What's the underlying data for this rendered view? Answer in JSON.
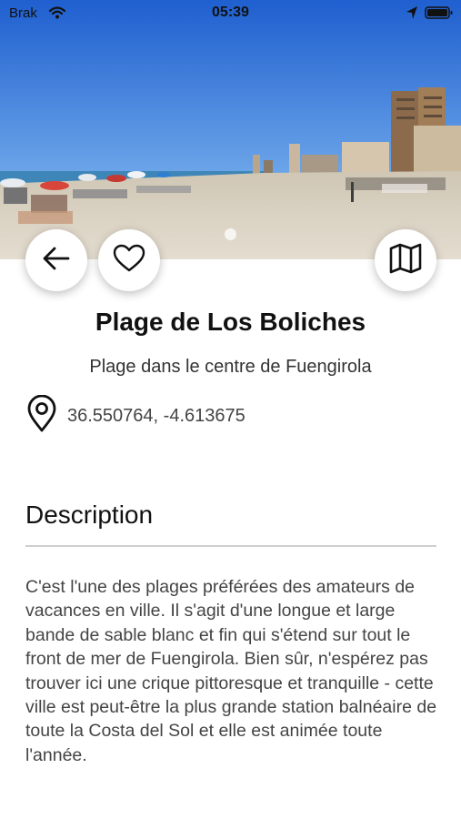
{
  "status_bar": {
    "carrier": "Brak",
    "time": "05:39",
    "icons": [
      "wifi-icon",
      "location-arrow-icon",
      "battery-icon"
    ]
  },
  "hero": {
    "image": "beach-photo",
    "pager": {
      "current_page": 1
    }
  },
  "actions": {
    "back": "arrow-left-icon",
    "favorite": "heart-icon",
    "map": "map-icon"
  },
  "place": {
    "title": "Plage de Los Boliches",
    "subtitle": "Plage dans le centre de Fuengirola",
    "coordinates": "36.550764, -4.613675",
    "coordinates_icon": "map-pin-icon"
  },
  "description": {
    "heading": "Description",
    "text": "C'est l'une des plages préférées des amateurs de vacances en ville. Il s'agit d'une longue et large bande de sable blanc et fin qui s'étend sur tout le front de mer de Fuengirola. Bien sûr, n'espérez pas trouver ici une crique pittoresque et tranquille - cette ville est peut-être la plus grande station balnéaire de toute la Costa del Sol et elle est animée toute l'année."
  },
  "colors": {
    "sky": "#2b6fd6",
    "sand": "#d9d2c4",
    "text": "#111111",
    "muted_text": "#444444",
    "divider": "#cfcfcf"
  }
}
